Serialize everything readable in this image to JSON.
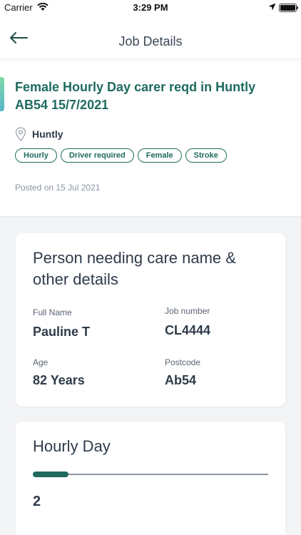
{
  "status_bar": {
    "carrier": "Carrier",
    "time": "3:29 PM"
  },
  "nav": {
    "title": "Job Details"
  },
  "job": {
    "title": "Female Hourly Day carer reqd in Huntly AB54 15/7/2021",
    "location": "Huntly",
    "tags": [
      "Hourly",
      "Driver required",
      "Female",
      "Stroke"
    ],
    "posted": "Posted on 15 Jul 2021"
  },
  "details": {
    "title": "Person needing care name & other details",
    "full_name_label": "Full Name",
    "full_name": "Pauline  T",
    "job_number_label": "Job number",
    "job_number": "CL4444",
    "age_label": "Age",
    "age": "82 Years",
    "postcode_label": "Postcode",
    "postcode": "Ab54"
  },
  "hours": {
    "title": "Hourly Day",
    "progress_fraction": 0.15,
    "value": "2"
  },
  "colors": {
    "brand": "#1e6b5e",
    "text": "#2f3b4a",
    "muted": "#8a94a3"
  }
}
